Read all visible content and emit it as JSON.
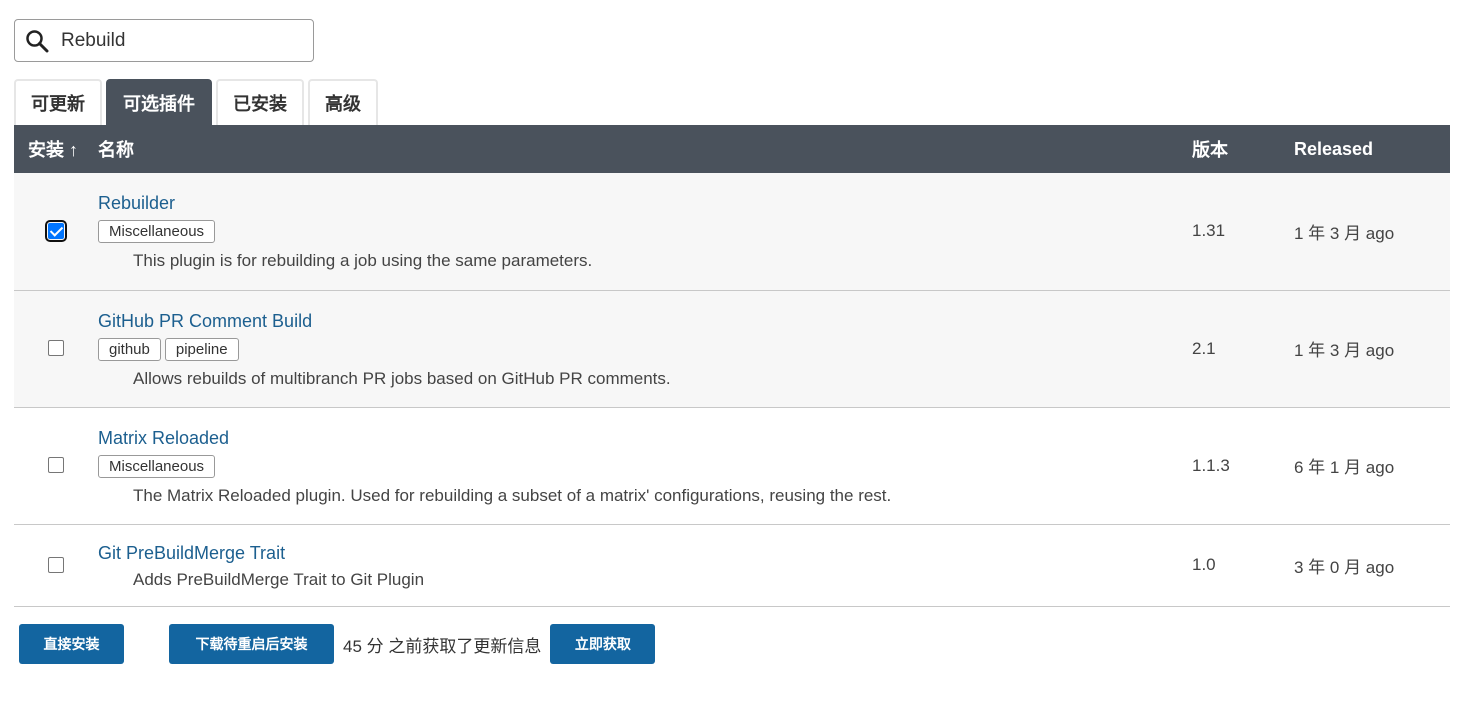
{
  "search": {
    "value": "Rebuild",
    "icon": "search-icon"
  },
  "tabs": [
    {
      "label": "可更新",
      "active": false
    },
    {
      "label": "可选插件",
      "active": true
    },
    {
      "label": "已安装",
      "active": false
    },
    {
      "label": "高级",
      "active": false
    }
  ],
  "table": {
    "headers": {
      "install": "安装 ↑",
      "name": "名称",
      "version": "版本",
      "released": "Released"
    },
    "rows": [
      {
        "name": "Rebuilder",
        "labels": [
          "Miscellaneous"
        ],
        "description": "This plugin is for rebuilding a job using the same parameters.",
        "version": "1.31",
        "released": "1 年 3 月 ago",
        "checked": true
      },
      {
        "name": "GitHub PR Comment Build",
        "labels": [
          "github",
          "pipeline"
        ],
        "description": "Allows rebuilds of multibranch PR jobs based on GitHub PR comments.",
        "version": "2.1",
        "released": "1 年 3 月 ago",
        "checked": false
      },
      {
        "name": "Matrix Reloaded",
        "labels": [
          "Miscellaneous"
        ],
        "description": "The Matrix Reloaded plugin. Used for rebuilding a subset of a matrix' configurations, reusing the rest.",
        "version": "1.1.3",
        "released": "6 年 1 月 ago",
        "checked": false
      },
      {
        "name": "Git PreBuildMerge Trait",
        "labels": [],
        "description": "Adds PreBuildMerge Trait to Git Plugin",
        "version": "1.0",
        "released": "3 年 0 月 ago",
        "checked": false
      }
    ]
  },
  "footer": {
    "install_now": "直接安装",
    "download_restart": "下载待重启后安装",
    "status": "45 分 之前获取了更新信息",
    "fetch_now": "立即获取"
  },
  "colors": {
    "header_bg": "#4a525c",
    "link": "#1c5f8f",
    "button": "#1365a0",
    "row_shade": "#f7f7f7"
  }
}
